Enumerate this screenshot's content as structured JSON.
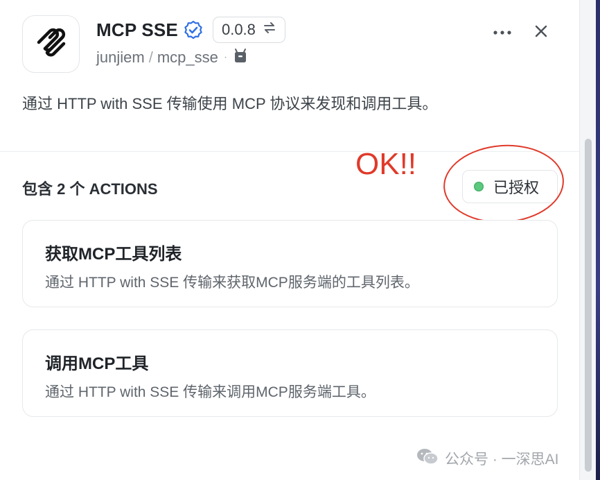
{
  "plugin": {
    "name": "MCP SSE",
    "version": "0.0.8",
    "owner": "junjiem",
    "repo": "mcp_sse",
    "description": "通过 HTTP with SSE 传输使用 MCP 协议来发现和调用工具。"
  },
  "actions_section": {
    "title": "包含 2 个 ACTIONS",
    "status_label": "已授权",
    "status_color": "#5cc97f",
    "items": [
      {
        "name": "获取MCP工具列表",
        "description": "通过 HTTP with SSE 传输来获取MCP服务端的工具列表。"
      },
      {
        "name": "调用MCP工具",
        "description": "通过 HTTP with SSE 传输来调用MCP服务端工具。"
      }
    ]
  },
  "annotation": {
    "text": "OK!!",
    "color": "#e03a2a"
  },
  "watermark": {
    "text": "公众号 · 一深思AI"
  },
  "icons": {
    "verified": "verified-check-icon",
    "version_switch": "swap-arrows-icon",
    "more": "more-dots-icon",
    "close": "close-icon",
    "package": "package-icon",
    "logo": "mcp-logo-icon",
    "wechat": "wechat-icon"
  },
  "colors": {
    "accent_verified": "#2f6fe4",
    "authorized_dot": "#5cc97f",
    "annotation_red": "#e03a2a"
  }
}
